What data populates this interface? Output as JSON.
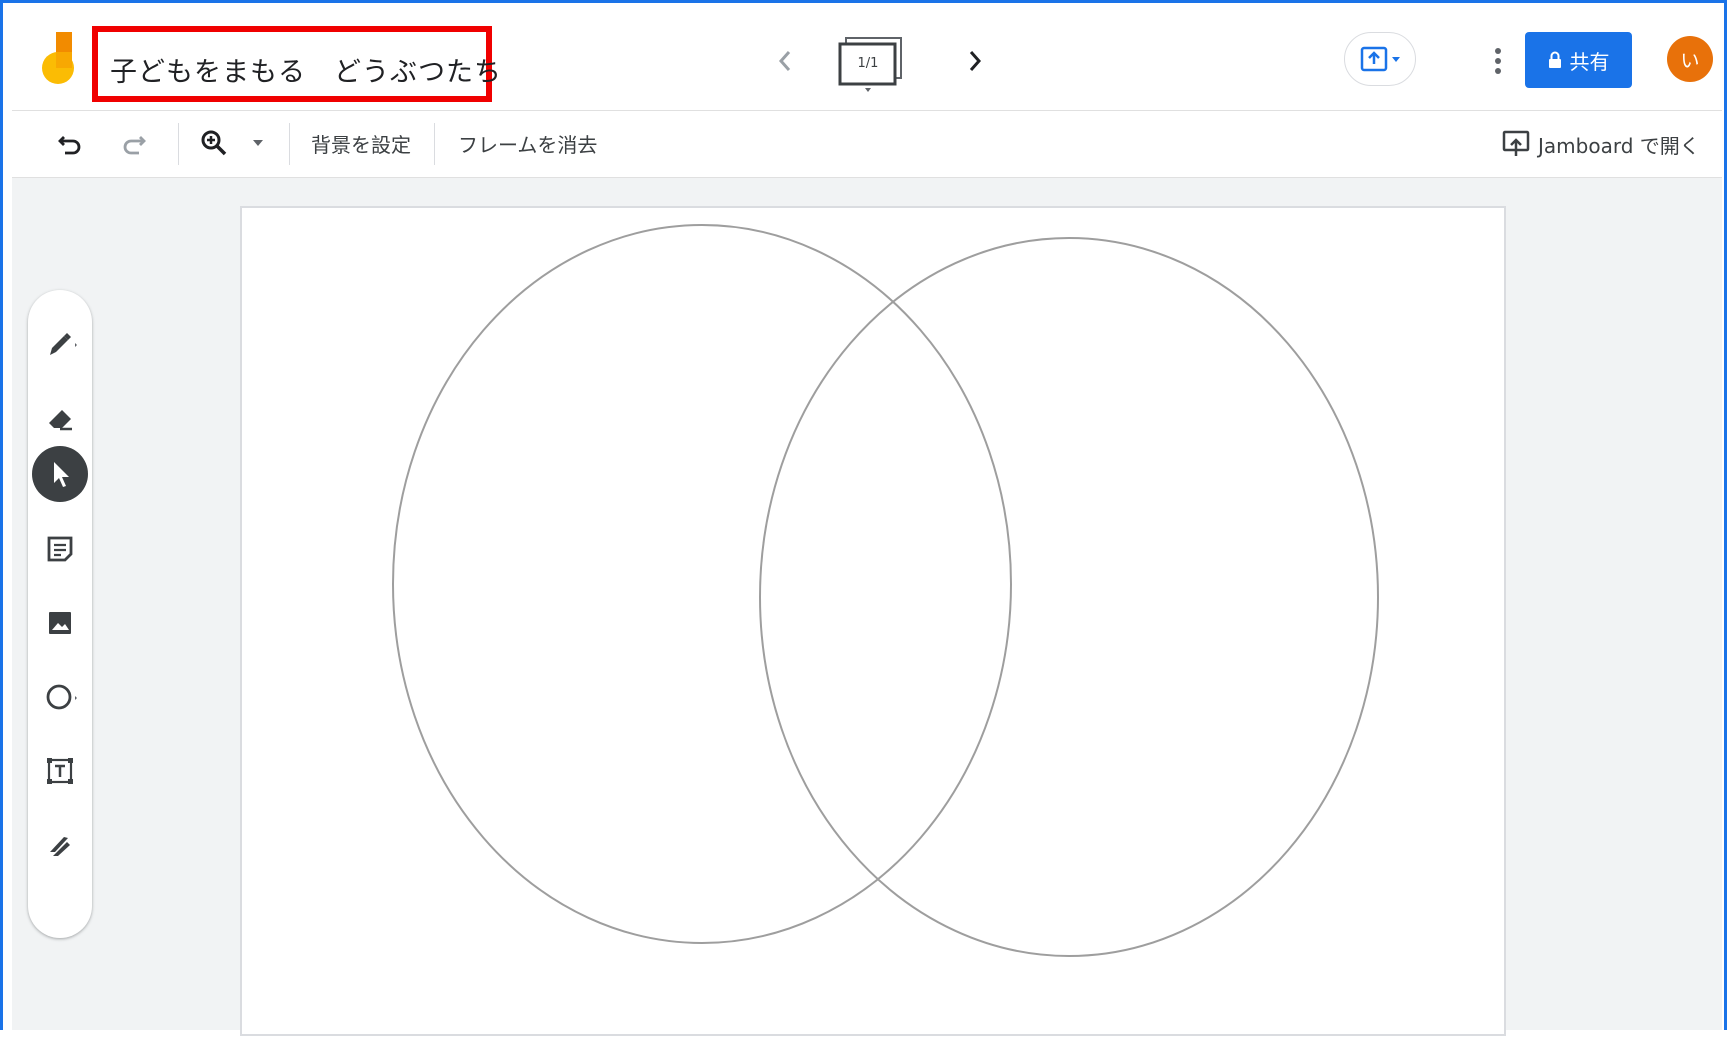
{
  "app": {
    "title": "子どもをまもる　どうぶつたち"
  },
  "header": {
    "frame_indicator": "1/1",
    "share_label": "共有",
    "avatar_initial": "い"
  },
  "toolbar": {
    "set_background_label": "背景を設定",
    "clear_frame_label": "フレームを消去",
    "open_in_jamboard_label": "Jamboard で開く"
  },
  "side_tools": [
    {
      "name": "pen-tool",
      "icon": "pen-icon"
    },
    {
      "name": "eraser-tool",
      "icon": "eraser-icon"
    },
    {
      "name": "select-tool",
      "icon": "cursor-icon",
      "active": true
    },
    {
      "name": "sticky-note-tool",
      "icon": "sticky-note-icon"
    },
    {
      "name": "add-image-tool",
      "icon": "image-icon"
    },
    {
      "name": "circle-tool",
      "icon": "circle-icon"
    },
    {
      "name": "text-box-tool",
      "icon": "text-box-icon"
    },
    {
      "name": "laser-tool",
      "icon": "laser-icon"
    }
  ],
  "colors": {
    "accent": "#1a73e8",
    "highlight_box": "#f00000",
    "avatar": "#e8710a",
    "workspace_bg": "#f1f3f4",
    "logo_yellow": "#fbbc04",
    "logo_orange": "#f28b00"
  },
  "canvas": {
    "shapes": [
      {
        "type": "ellipse",
        "name": "left-circle"
      },
      {
        "type": "ellipse",
        "name": "right-circle"
      }
    ]
  }
}
